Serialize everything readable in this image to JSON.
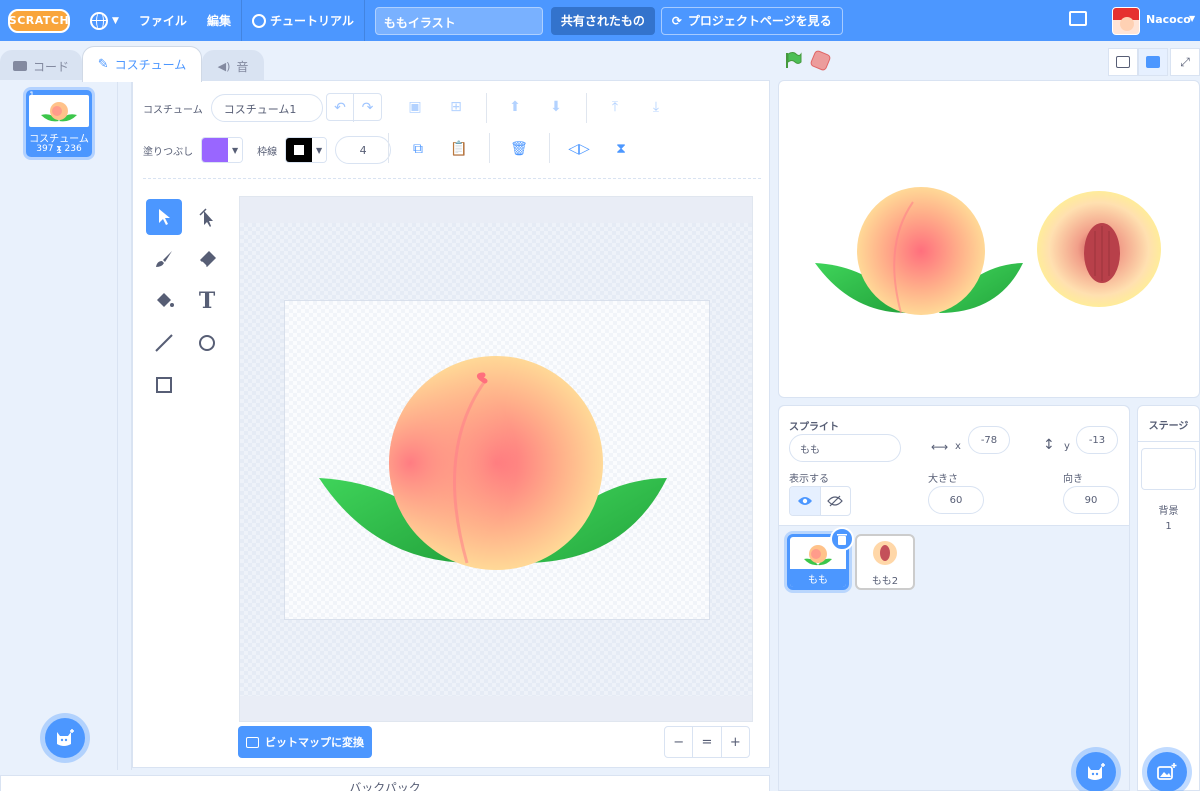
{
  "menubar": {
    "logo_text": "SCRATCH",
    "file_label": "ファイル",
    "edit_label": "編集",
    "tutorial_label": "チュートリアル",
    "project_title": "ももイラスト",
    "shared_label": "共有されたもの",
    "project_page_label": "プロジェクトページを見る",
    "username": "Nacoco"
  },
  "tabs": [
    {
      "label": "コード",
      "icon": "code-icon"
    },
    {
      "label": "コスチューム",
      "icon": "brush-icon"
    },
    {
      "label": "音",
      "icon": "speaker-icon"
    }
  ],
  "costume_list": {
    "items": [
      {
        "number": "1",
        "name": "コスチューム1",
        "size": "397 x 236"
      }
    ]
  },
  "paint_editor": {
    "costume_label": "コスチューム",
    "costume_name": "コスチューム1",
    "fill_label": "塗りつぶし",
    "outline_label": "枠線",
    "outline_width": "4",
    "fill_color": "#9966ff",
    "outline_color": "#000000",
    "convert_button_label": "ビットマップに変換",
    "zoom_labels": [
      "−",
      "=",
      "+"
    ]
  },
  "backpack_label": "バックパック",
  "sprite_info": {
    "sprite_label": "スプライト",
    "sprite_name": "もも",
    "x_label": "x",
    "x_value": "-78",
    "y_label": "y",
    "y_value": "-13",
    "show_label": "表示する",
    "size_label": "大きさ",
    "size_value": "60",
    "direction_label": "向き",
    "direction_value": "90"
  },
  "sprites": [
    {
      "name": "もも",
      "selected": true
    },
    {
      "name": "もも2",
      "selected": false
    }
  ],
  "stage_pane": {
    "title": "ステージ",
    "backdrop_label": "背景",
    "backdrop_count": "1"
  },
  "colors": {
    "accent": "#4c97ff",
    "menubar": "#4c97ff",
    "peach_light": "#ffe39a",
    "peach_pink": "#ff6f7d",
    "leaf": "#2fbf3f"
  }
}
